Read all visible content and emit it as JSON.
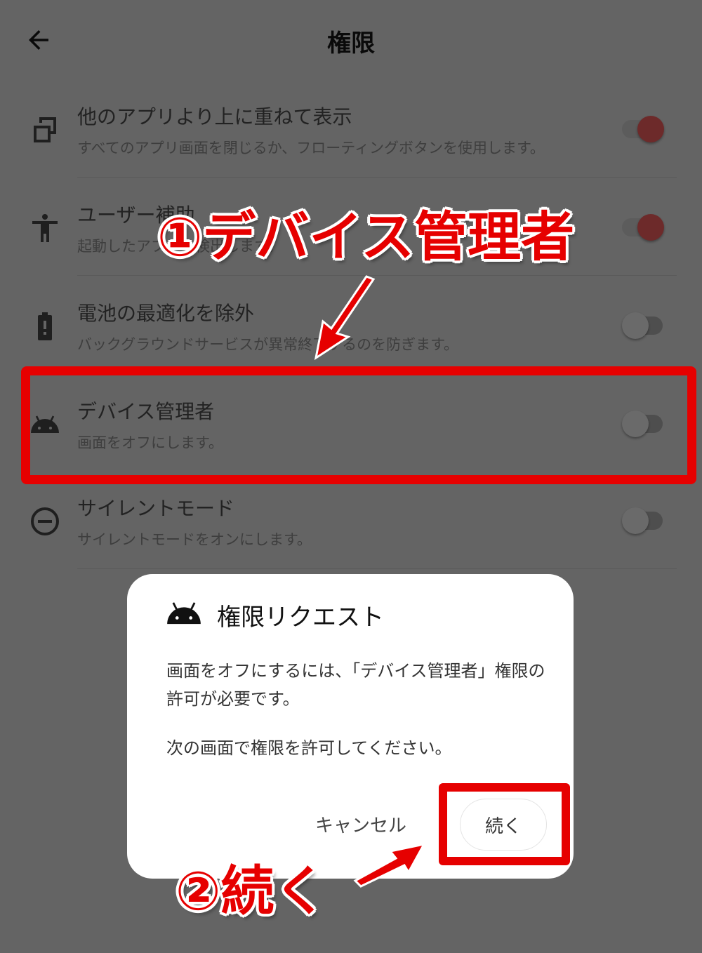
{
  "header": {
    "title": "権限",
    "back_icon": "arrow-left-icon"
  },
  "permissions": [
    {
      "icon": "overlay-windows-icon",
      "title": "他のアプリより上に重ねて表示",
      "subtitle": "すべてのアプリ画面を閉じるか、フローティングボタンを使用します。",
      "enabled": true
    },
    {
      "icon": "accessibility-icon",
      "title": "ユーザー補助",
      "subtitle": "起動したアプリを検出します。",
      "enabled": true
    },
    {
      "icon": "battery-alert-icon",
      "title": "電池の最適化を除外",
      "subtitle": "バックグラウンドサービスが異常終了するのを防ぎます。",
      "enabled": false
    },
    {
      "icon": "android-icon",
      "title": "デバイス管理者",
      "subtitle": "画面をオフにします。",
      "enabled": false
    },
    {
      "icon": "do-not-disturb-icon",
      "title": "サイレントモード",
      "subtitle": "サイレントモードをオンにします。",
      "enabled": false
    }
  ],
  "dialog": {
    "icon": "android-icon",
    "title": "権限リクエスト",
    "body_1": "画面をオフにするには、「デバイス管理者」権限の許可が必要です。",
    "body_2": "次の画面で権限を許可してください。",
    "cancel_label": "キャンセル",
    "continue_label": "続く"
  },
  "annotations": {
    "step1": "①デバイス管理者",
    "step2": "②続く",
    "color": "#e60000"
  },
  "colors": {
    "scrim": "#646464",
    "toggle_on_thumb": "#6d2a2a"
  }
}
